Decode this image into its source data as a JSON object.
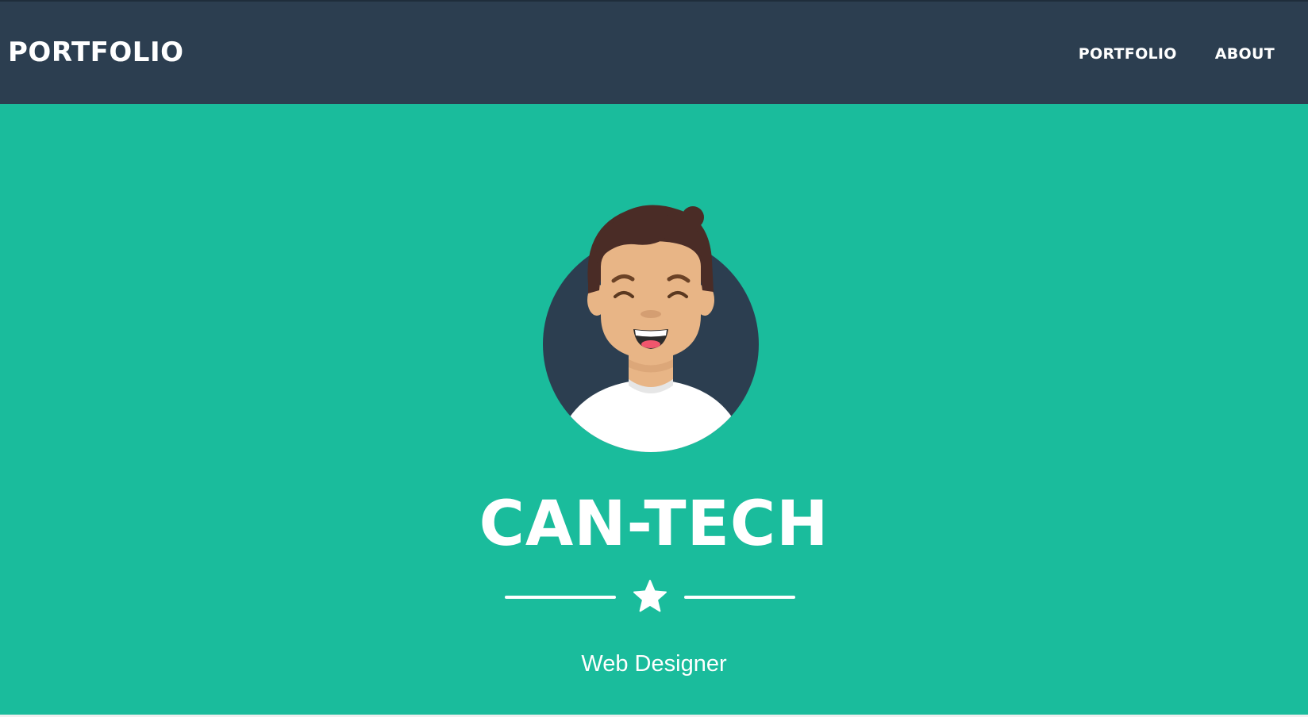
{
  "navbar": {
    "brand": "PORTFOLIO",
    "links": [
      {
        "label": "PORTFOLIO"
      },
      {
        "label": "ABOUT"
      }
    ]
  },
  "hero": {
    "title": "CAN-TECH",
    "subtitle": "Web Designer",
    "avatar_icon": "smiling-man-avatar-icon",
    "divider_icon": "star-icon"
  },
  "colors": {
    "navbar_bg": "#2c3e50",
    "hero_bg": "#1abc9c",
    "text": "#ffffff"
  }
}
